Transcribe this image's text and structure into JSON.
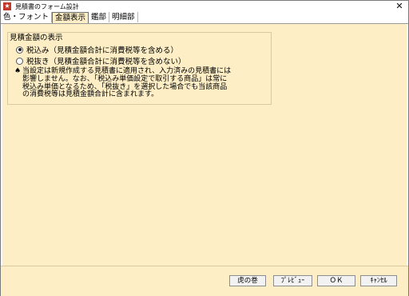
{
  "window": {
    "title": "見積書のフォーム設計",
    "close_glyph": "✕"
  },
  "tabs": [
    {
      "label": "色・フォント"
    },
    {
      "label": "金額表示"
    },
    {
      "label": "鑑部"
    },
    {
      "label": "明細部"
    }
  ],
  "group": {
    "title": "見積金額の表示",
    "options": [
      {
        "label": "税込み（見積金額合計に消費税等を含める）",
        "checked": true
      },
      {
        "label": "税抜き（見積金額合計に消費税等を含めない）",
        "checked": false
      }
    ],
    "note_icon": "♠",
    "note": "当設定は新規作成する見積書に適用され、入力済みの見積書には\n影響しません。なお、「税込み単価設定で取引する商品」は常に\n税込み単価となるため、「税抜き」を選択した場合でも当該商品\nの消費税等は見積金額合計に含まれます。"
  },
  "footer": {
    "buttons": [
      {
        "label": "虎の巻"
      },
      {
        "label": "ﾌﾟﾚﾋﾞｭｰ"
      },
      {
        "label": "ＯＫ"
      },
      {
        "label": "ｷｬﾝｾﾙ"
      }
    ]
  }
}
